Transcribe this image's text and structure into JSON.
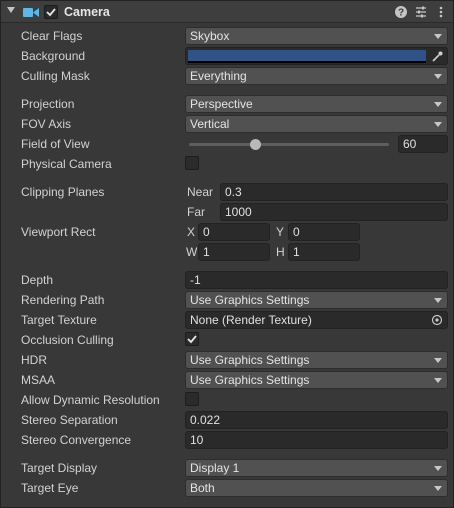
{
  "header": {
    "title": "Camera",
    "enabled": true,
    "icons": [
      "fold-arrow-icon",
      "camera-icon",
      "help-icon",
      "preset-icon",
      "more-icon"
    ]
  },
  "colors": {
    "background_swatch": "#315287",
    "panel": "#383838",
    "dropdown": "#515151",
    "field": "#2a2a2a"
  },
  "rows": {
    "clear_flags": {
      "label": "Clear Flags",
      "value": "Skybox"
    },
    "background": {
      "label": "Background"
    },
    "culling_mask": {
      "label": "Culling Mask",
      "value": "Everything"
    },
    "projection": {
      "label": "Projection",
      "value": "Perspective"
    },
    "fov_axis": {
      "label": "FOV Axis",
      "value": "Vertical"
    },
    "field_of_view": {
      "label": "Field of View",
      "value": "60",
      "slider_fraction": 0.33
    },
    "physical_camera": {
      "label": "Physical Camera",
      "checked": false
    },
    "clipping_planes": {
      "label": "Clipping Planes",
      "near_label": "Near",
      "near_value": "0.3",
      "far_label": "Far",
      "far_value": "1000"
    },
    "viewport_rect": {
      "label": "Viewport Rect",
      "x_label": "X",
      "x": "0",
      "y_label": "Y",
      "y": "0",
      "w_label": "W",
      "w": "1",
      "h_label": "H",
      "h": "1"
    },
    "depth": {
      "label": "Depth",
      "value": "-1"
    },
    "rendering_path": {
      "label": "Rendering Path",
      "value": "Use Graphics Settings"
    },
    "target_texture": {
      "label": "Target Texture",
      "value": "None (Render Texture)"
    },
    "occlusion_culling": {
      "label": "Occlusion Culling",
      "checked": true
    },
    "hdr": {
      "label": "HDR",
      "value": "Use Graphics Settings"
    },
    "msaa": {
      "label": "MSAA",
      "value": "Use Graphics Settings"
    },
    "allow_dynamic_resolution": {
      "label": "Allow Dynamic Resolution",
      "checked": false
    },
    "stereo_separation": {
      "label": "Stereo Separation",
      "value": "0.022"
    },
    "stereo_convergence": {
      "label": "Stereo Convergence",
      "value": "10"
    },
    "target_display": {
      "label": "Target Display",
      "value": "Display 1"
    },
    "target_eye": {
      "label": "Target Eye",
      "value": "Both"
    }
  }
}
